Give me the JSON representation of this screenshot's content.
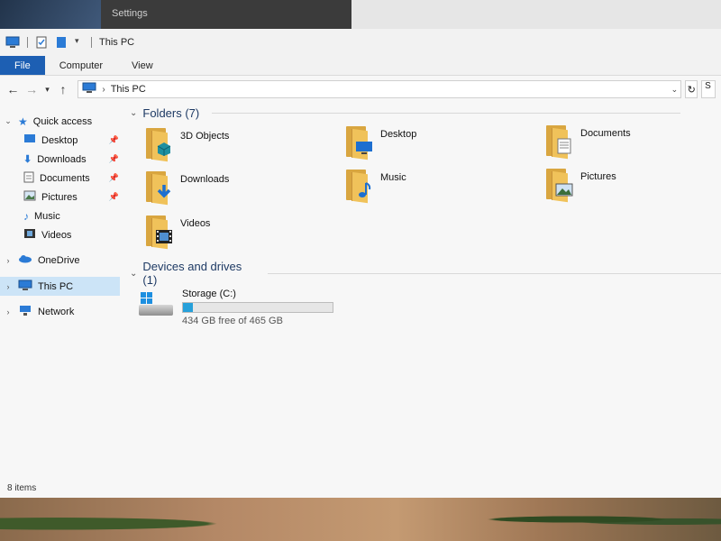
{
  "background_window": {
    "title": "Settings"
  },
  "window": {
    "title": "This PC",
    "ribbon_tabs": [
      "File",
      "Computer",
      "View"
    ],
    "address": {
      "path": "This PC",
      "search_placeholder": "S"
    }
  },
  "nav": {
    "quick_access": "Quick access",
    "items": [
      {
        "label": "Desktop",
        "pinned": true,
        "icon": "desktop-icon"
      },
      {
        "label": "Downloads",
        "pinned": true,
        "icon": "download-arrow-icon"
      },
      {
        "label": "Documents",
        "pinned": true,
        "icon": "document-icon"
      },
      {
        "label": "Pictures",
        "pinned": true,
        "icon": "picture-icon"
      },
      {
        "label": "Music",
        "pinned": false,
        "icon": "music-note-icon"
      },
      {
        "label": "Videos",
        "pinned": false,
        "icon": "video-icon"
      }
    ],
    "onedrive": "OneDrive",
    "this_pc": "This PC",
    "network": "Network"
  },
  "folders": {
    "header": "Folders (7)",
    "items": [
      {
        "label": "3D Objects",
        "icon": "3d-objects-folder-icon"
      },
      {
        "label": "Desktop",
        "icon": "desktop-folder-icon"
      },
      {
        "label": "Documents",
        "icon": "documents-folder-icon"
      },
      {
        "label": "Downloads",
        "icon": "downloads-folder-icon"
      },
      {
        "label": "Music",
        "icon": "music-folder-icon"
      },
      {
        "label": "Pictures",
        "icon": "pictures-folder-icon"
      },
      {
        "label": "Videos",
        "icon": "videos-folder-icon"
      }
    ]
  },
  "drives": {
    "header": "Devices and drives (1)",
    "items": [
      {
        "label": "Storage (C:)",
        "free_text": "434 GB free of 465 GB",
        "used_fraction": 0.067
      }
    ]
  },
  "status": {
    "items_count": "8 items"
  },
  "colors": {
    "accent": "#1d5fb3",
    "folder": "#f0c25a",
    "drive_bar": "#26a0da",
    "selection": "#cce4f7"
  }
}
